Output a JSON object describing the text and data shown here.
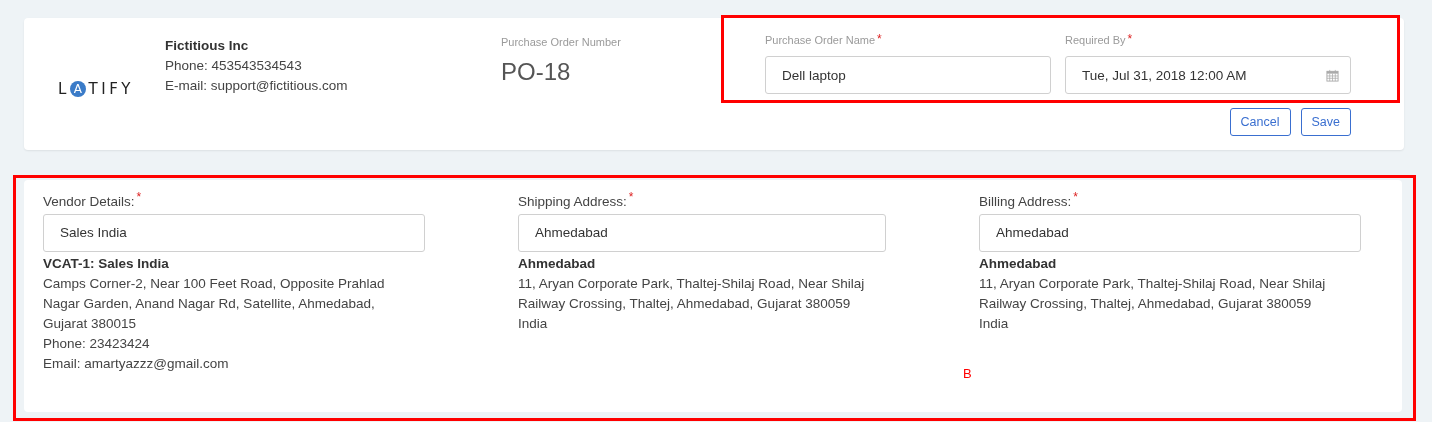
{
  "header": {
    "logo": {
      "before": "L",
      "circled": "A",
      "after": "TIFY"
    },
    "company": {
      "name": "Fictitious Inc",
      "phone": "Phone: 453543534543",
      "email": "E-mail: support@fictitious.com"
    },
    "po_number": {
      "label": "Purchase Order Number",
      "value": "PO-18"
    },
    "fields": [
      {
        "kind": "text",
        "label": "Purchase Order Name",
        "required_mark": "*",
        "value": "Dell laptop"
      },
      {
        "kind": "date",
        "label": "Required By",
        "required_mark": "*",
        "value": "Tue, Jul 31, 2018 12:00 AM"
      }
    ],
    "buttons": [
      "Cancel",
      "Save"
    ]
  },
  "addresses": [
    {
      "label": "Vendor Details:",
      "required_mark": "*",
      "value": "Sales India",
      "title": "VCAT-1: Sales India",
      "address": "Camps Corner-2, Near 100 Feet Road, Opposite Prahlad Nagar Garden, Anand Nagar Rd, Satellite, Ahmedabad, Gujarat 380015",
      "extra": [
        "Phone: 23423424",
        "Email: amartyazzz@gmail.com"
      ]
    },
    {
      "label": "Shipping Address:",
      "required_mark": "*",
      "value": "Ahmedabad",
      "title": "Ahmedabad",
      "address": "11, Aryan Corporate Park, Thaltej-Shilaj Road, Near Shilaj Railway Crossing, Thaltej, Ahmedabad, Gujarat 380059",
      "extra": [
        "India"
      ]
    },
    {
      "label": "Billing Address:",
      "required_mark": "*",
      "value": "Ahmedabad",
      "title": "Ahmedabad",
      "address": "11, Aryan Corporate Park, Thaltej-Shilaj Road, Near Shilaj Railway Crossing, Thaltej, Ahmedabad, Gujarat 380059",
      "extra": [
        "India"
      ]
    }
  ],
  "annotations": [
    {
      "kind": "frame"
    },
    {
      "kind": "frame",
      "label": "B"
    }
  ]
}
